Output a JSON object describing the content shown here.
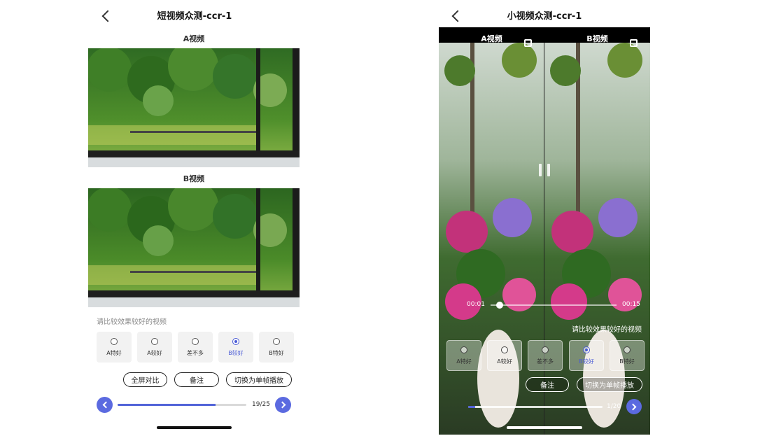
{
  "left_screen": {
    "title": "短视频众测-ccr-1",
    "video_a_label": "A视频",
    "video_b_label": "B视频",
    "hint": "请比较效果较好的视频",
    "options": [
      {
        "label": "A特好",
        "selected": false
      },
      {
        "label": "A较好",
        "selected": false
      },
      {
        "label": "差不多",
        "selected": false
      },
      {
        "label": "B较好",
        "selected": true
      },
      {
        "label": "B特好",
        "selected": false
      }
    ],
    "buttons": {
      "fullscreen_compare": "全屏对比",
      "note": "备注",
      "switch_single": "切换为单帧播放"
    },
    "progress": {
      "current": 19,
      "total": 25,
      "label": "19/25",
      "fraction": 0.76
    }
  },
  "right_screen": {
    "title": "小视频众测-ccr-1",
    "label_a": "A视频",
    "label_b": "B视频",
    "time_current": "00:01",
    "time_total": "00:15",
    "playback_fraction": 0.07,
    "hint": "请比较效果较好的视频",
    "options": [
      {
        "label": "A特好",
        "selected": false
      },
      {
        "label": "A较好",
        "selected": false
      },
      {
        "label": "差不多",
        "selected": false
      },
      {
        "label": "B较好",
        "selected": true
      },
      {
        "label": "B特好",
        "selected": false
      }
    ],
    "buttons": {
      "note": "备注",
      "switch_single": "切换为单帧播放"
    },
    "progress": {
      "current": 1,
      "total": 20,
      "label": "1/20",
      "fraction": 0.05
    }
  },
  "colors": {
    "accent": "#5b6ae0",
    "progress_fill": "#5264d8",
    "hint_gray": "#8a8a8a"
  },
  "icons": [
    "back-chevron-icon",
    "fullscreen-icon",
    "pause-icon",
    "prev-arrow-icon",
    "next-arrow-icon"
  ]
}
